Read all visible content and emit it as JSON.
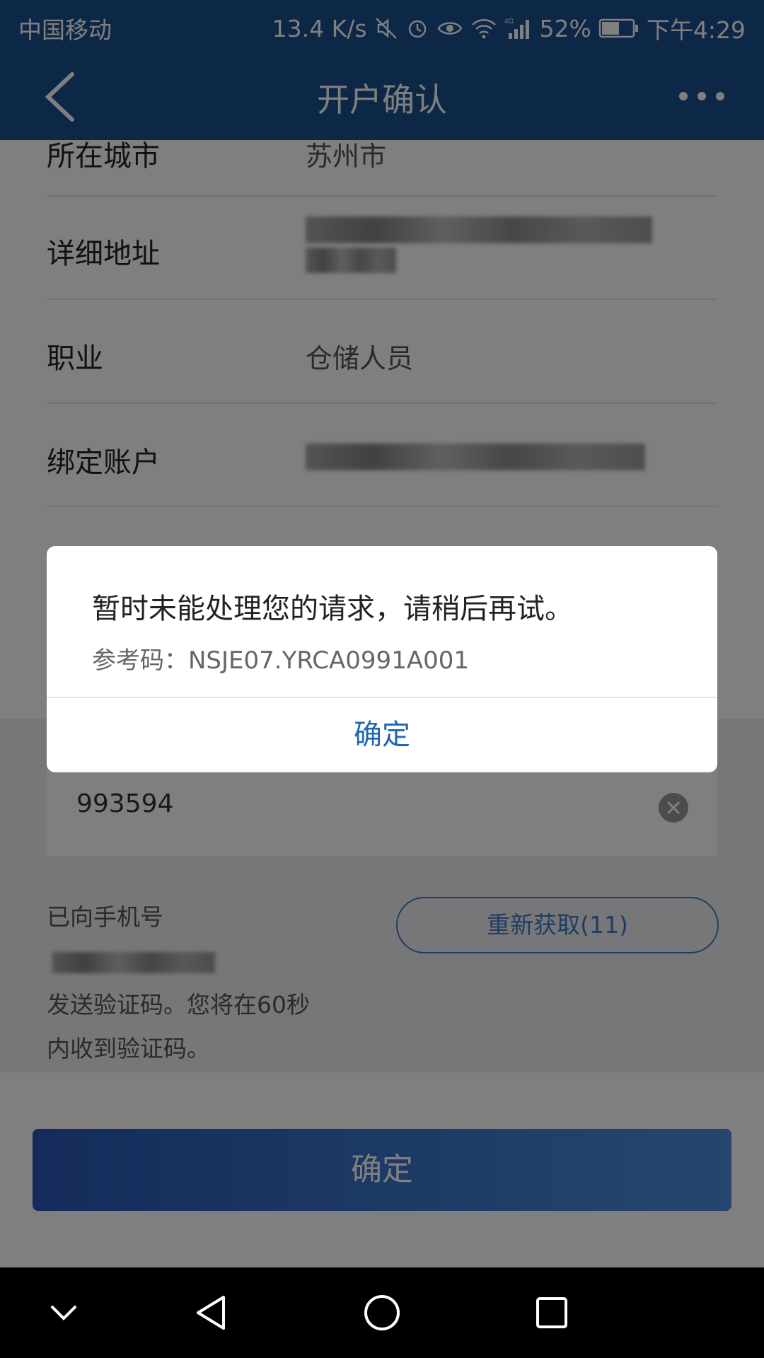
{
  "status_bar": {
    "carrier": "中国移动",
    "net_speed": "13.4 K/s",
    "battery": "52%",
    "time": "下午4:29",
    "network_label": "4G"
  },
  "nav": {
    "title": "开户确认"
  },
  "form": {
    "rows": [
      {
        "label": "所在城市",
        "value": "苏州市"
      },
      {
        "label": "详细地址",
        "value": ""
      },
      {
        "label": "职业",
        "value": "仓储人员"
      },
      {
        "label": "绑定账户",
        "value": ""
      }
    ],
    "code_value": "993594",
    "sms_hint_prefix": "已向手机号",
    "sms_hint_line2": "发送验证码。您将在60秒",
    "sms_hint_line3": "内收到验证码。",
    "resend_label": "重新获取(11)"
  },
  "main_button": "确定",
  "dialog": {
    "message": "暂时未能处理您的请求，请稍后再试。",
    "ref_code": "参考码：NSJE07.YRCA0991A001",
    "ok_label": "确定"
  },
  "colors": {
    "nav_blue": "#1a4f8e",
    "accent_blue": "#1f66b5"
  },
  "icons": [
    "back-arrow-icon",
    "more-icon",
    "clear-icon",
    "mute-icon",
    "alarm-icon",
    "eye-icon",
    "wifi-icon",
    "signal-icon",
    "battery-icon",
    "nav-down-icon",
    "nav-back-icon",
    "nav-home-icon",
    "nav-recents-icon"
  ]
}
